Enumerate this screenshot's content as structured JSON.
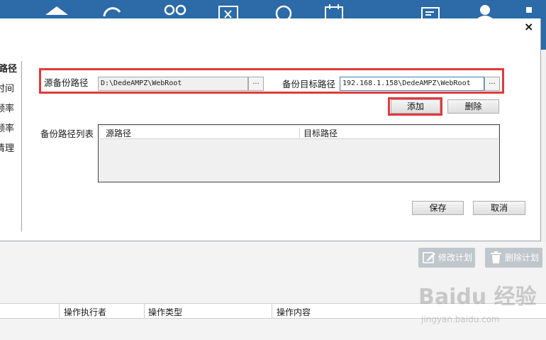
{
  "dialog": {
    "close": "×",
    "left_menu": [
      "路径",
      "时间",
      "频率",
      "频率",
      "清理"
    ],
    "source_label": "源备份路径",
    "source_value": "D:\\DedeAMPZ\\WebRoot",
    "browse": "...",
    "target_label": "备份目标路径",
    "target_value": "192.168.1.158\\DedeAMPZ\\WebRoot",
    "add": "添加",
    "delete": "删除",
    "list_label": "备份路径列表",
    "list_columns": [
      "源路径",
      "目标路径"
    ],
    "save": "保存",
    "cancel": "取消"
  },
  "actions": {
    "edit_plan": "修改计划",
    "delete_plan": "删除计划"
  },
  "log_columns": [
    "操作执行者",
    "操作类型",
    "操作内容"
  ],
  "watermark": {
    "main": "Baidu 经验",
    "sub": "jingyan.baidu.com"
  },
  "colors": {
    "toolbar": "#2c6aa8",
    "highlight": "#e13a3a",
    "action_button": "#bfc6cc"
  },
  "icons": [
    "home-icon",
    "refresh-icon",
    "users-icon",
    "excel-icon",
    "search-icon",
    "calendar-icon",
    "report-icon",
    "user-icon",
    "grid-icon",
    "edit-icon",
    "trash-icon"
  ]
}
